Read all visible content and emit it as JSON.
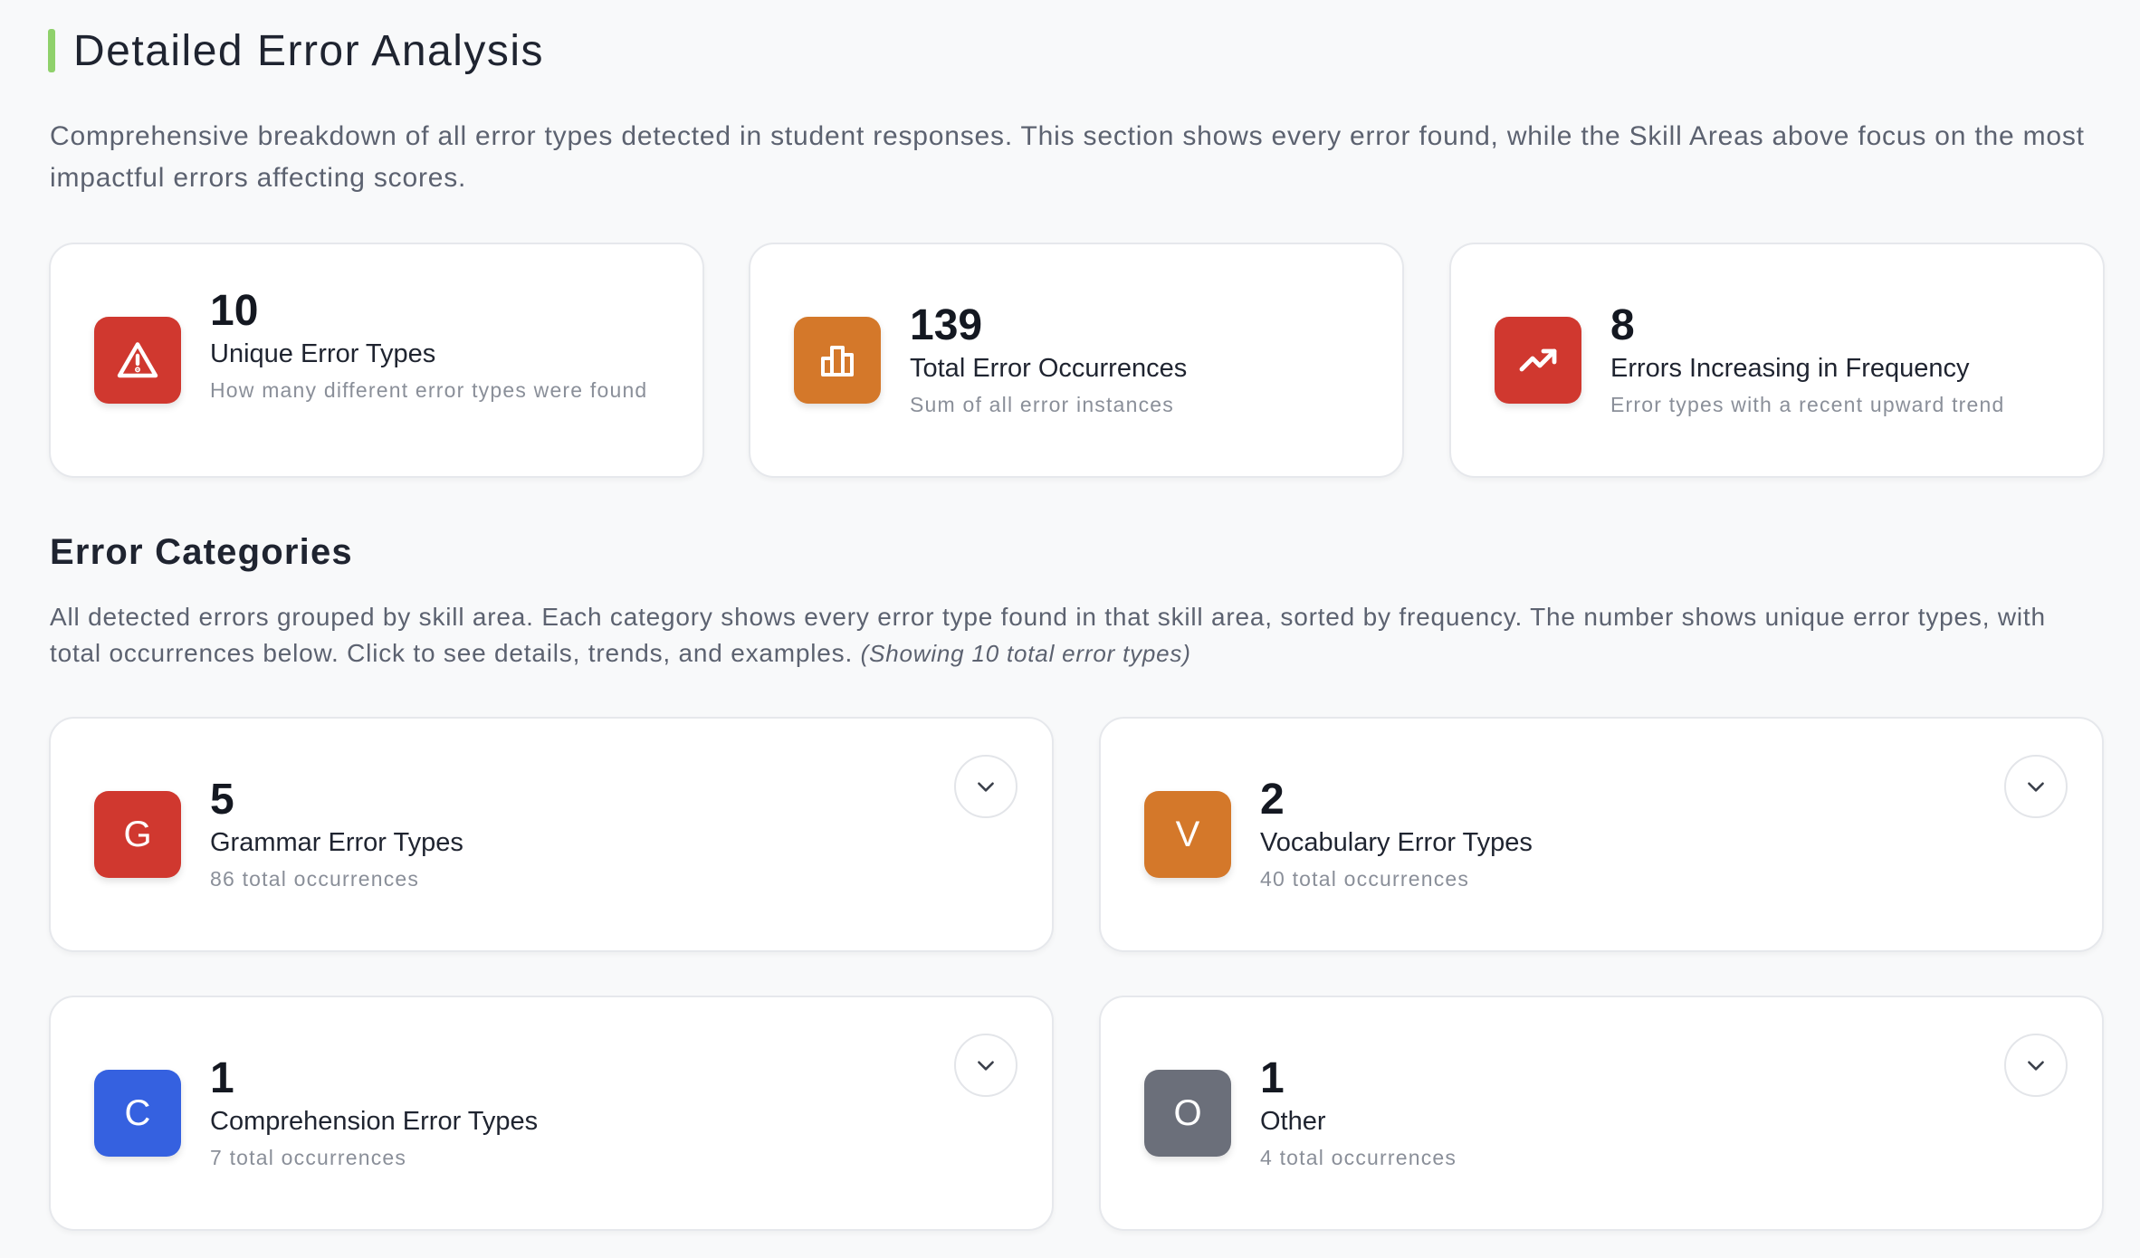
{
  "section": {
    "title": "Detailed Error Analysis",
    "description": "Comprehensive breakdown of all error types detected in student responses. This section shows every error found, while the Skill Areas above focus on the most impactful errors affecting scores.",
    "accent_color": "#8fd16b"
  },
  "summary_cards": [
    {
      "icon": "alert-triangle-icon",
      "color": "#d0382f",
      "value": "10",
      "label": "Unique Error Types",
      "sub": "How many different error types were found"
    },
    {
      "icon": "bar-chart-icon",
      "color": "#d4782a",
      "value": "139",
      "label": "Total Error Occurrences",
      "sub": "Sum of all error instances"
    },
    {
      "icon": "trending-up-icon",
      "color": "#d0382f",
      "value": "8",
      "label": "Errors Increasing in Frequency",
      "sub": "Error types with a recent upward trend"
    }
  ],
  "categories": {
    "title": "Error Categories",
    "description": "All detected errors grouped by skill area. Each category shows every error type found in that skill area, sorted by frequency. The number shows unique error types, with total occurrences below. Click to see details, trends, and examples.",
    "note": "(Showing 10 total error types)",
    "items": [
      {
        "letter": "G",
        "color": "#d0382f",
        "count": "5",
        "label": "Grammar Error Types",
        "occurrences": "86 total occurrences"
      },
      {
        "letter": "V",
        "color": "#d4782a",
        "count": "2",
        "label": "Vocabulary Error Types",
        "occurrences": "40 total occurrences"
      },
      {
        "letter": "C",
        "color": "#3561e0",
        "count": "1",
        "label": "Comprehension Error Types",
        "occurrences": "7 total occurrences"
      },
      {
        "letter": "O",
        "color": "#6b6f7a",
        "count": "1",
        "label": "Other",
        "occurrences": "4 total occurrences"
      }
    ]
  }
}
